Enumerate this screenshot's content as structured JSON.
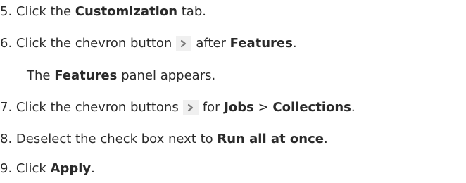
{
  "steps": [
    {
      "num": "5.",
      "pre": "Click the ",
      "bold": "Customization",
      "post": " tab."
    },
    {
      "num": "6.",
      "pre": "Click the chevron button",
      "mid": "after ",
      "bold": "Features",
      "post": "."
    },
    {
      "note_pre": "The ",
      "note_bold": "Features",
      "note_post": " panel appears."
    },
    {
      "num": "7.",
      "pre": "Click the chevron buttons",
      "mid": "for ",
      "bold": "Jobs",
      "sep": " > ",
      "bold2": "Collections",
      "post": "."
    },
    {
      "num": "8.",
      "pre": "Deselect the check box next to ",
      "bold": "Run all at once",
      "post": "."
    },
    {
      "num": "9.",
      "pre": "Click ",
      "bold": "Apply",
      "post": "."
    }
  ],
  "icons": {
    "chevron": "chevron-right-icon",
    "chevron_color": "#7a7a7a",
    "chevron_bg": "#f0f0f0"
  }
}
